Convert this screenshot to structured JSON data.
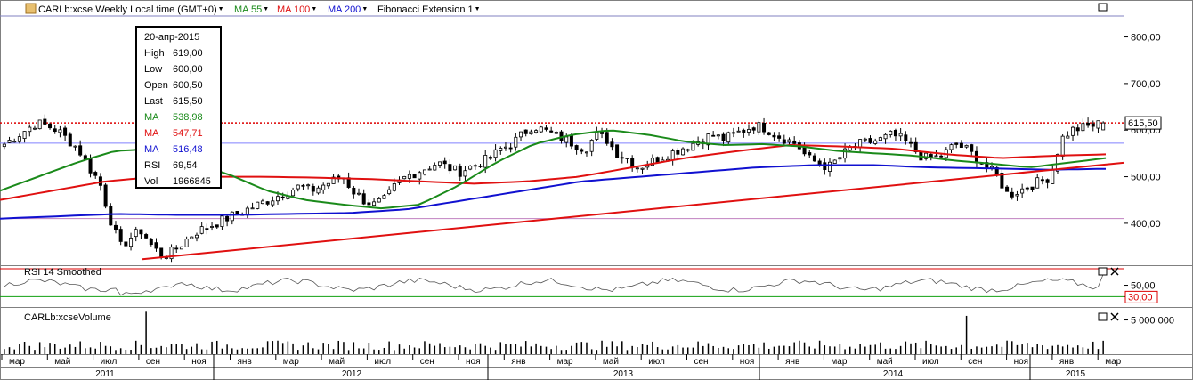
{
  "header": {
    "title": "CARLb:xcse Weekly Local time (GMT+0)",
    "ma55": "MA 55",
    "ma100": "MA 100",
    "ma200": "MA 200",
    "fib": "Fibonacci Extension 1"
  },
  "rsi_panel": {
    "title": "RSI 14 Smoothed"
  },
  "volume_panel": {
    "title": "CARLb:xcseVolume"
  },
  "tooltip": {
    "date": "20-апр-2015",
    "rows": [
      {
        "k": "High",
        "v": "619,00"
      },
      {
        "k": "Low",
        "v": "600,00"
      },
      {
        "k": "Open",
        "v": "600,50"
      },
      {
        "k": "Last",
        "v": "615,50"
      },
      {
        "k": "MA",
        "v": "538,98"
      },
      {
        "k": "MA",
        "v": "547,71"
      },
      {
        "k": "MA",
        "v": "516,48"
      },
      {
        "k": "RSI",
        "v": "69,54"
      },
      {
        "k": "Vol",
        "v": "1966845"
      }
    ]
  },
  "colors": {
    "ma55": "#1a8a1a",
    "ma100": "#e01010",
    "ma200": "#1010d0",
    "trend": "#e01010",
    "bg": "#ffffff",
    "grid": "#c0c0c0"
  },
  "chart_data": {
    "type": "candlestick",
    "price_axis": {
      "ticks": [
        "800,00",
        "700,00",
        "600,00",
        "500,00",
        "400,00"
      ],
      "tick_values": [
        800,
        700,
        600,
        500,
        400
      ],
      "ylim": [
        310,
        845
      ]
    },
    "current_price_label": "615,50",
    "current_price": 615.5,
    "reference_lines": [
      572,
      410
    ],
    "rsi_axis": {
      "ticks": [
        "50,00",
        "30,00"
      ],
      "tick_values": [
        50,
        30
      ],
      "ylim": [
        15,
        82
      ]
    },
    "volume_axis": {
      "ticks": [
        "5 000 000"
      ],
      "tick_values": [
        5000000
      ],
      "ylim": [
        0,
        6500000
      ]
    },
    "x_axis": {
      "months": [
        "мар",
        "май",
        "июл",
        "сен",
        "ноя",
        "янв",
        "мар",
        "май",
        "июл",
        "сен",
        "ноя",
        "янв",
        "мар",
        "май",
        "июл",
        "сен",
        "ноя",
        "янв",
        "мар",
        "май",
        "июл",
        "сен",
        "ноя",
        "янв",
        "мар"
      ],
      "years": [
        "2011",
        "2012",
        "2013",
        "2014",
        "2015"
      ]
    },
    "last_bar": {
      "date": "20-апр-2015",
      "high": 619.0,
      "low": 600.0,
      "open": 600.5,
      "close": 615.5,
      "ma55": 538.98,
      "ma100": 547.71,
      "ma200": 516.48,
      "rsi": 69.54,
      "volume": 1966845
    },
    "price_anchors": [
      570,
      585,
      600,
      615,
      610,
      600,
      580,
      560,
      520,
      490,
      410,
      350,
      370,
      385,
      350,
      330,
      340,
      360,
      380,
      390,
      400,
      410,
      420,
      430,
      440,
      450,
      460,
      470,
      480,
      470,
      480,
      490,
      500,
      470,
      450,
      440,
      450,
      480,
      500,
      510,
      520,
      530,
      520,
      510,
      520,
      530,
      540,
      560,
      570,
      590,
      610,
      600,
      590,
      580,
      570,
      560,
      590,
      580,
      550,
      540,
      520,
      530,
      540,
      550,
      560,
      570,
      580,
      590,
      580,
      590,
      600,
      610,
      605,
      590,
      580,
      570,
      540,
      530,
      520,
      540,
      560,
      570,
      575,
      580,
      590,
      580,
      560,
      540,
      540,
      550,
      570,
      560,
      540,
      520,
      500,
      460,
      470,
      480,
      490,
      500,
      580,
      600,
      605,
      610,
      615.5
    ],
    "ma55_anchors": [
      470,
      500,
      530,
      555,
      560,
      530,
      505,
      470,
      450,
      440,
      432,
      440,
      480,
      530,
      570,
      590,
      600,
      590,
      575,
      568,
      570,
      565,
      555,
      550,
      545,
      535,
      528,
      520,
      530,
      540
    ],
    "ma100_anchors": [
      450,
      470,
      490,
      500,
      500,
      500,
      498,
      495,
      490,
      485,
      490,
      500,
      520,
      540,
      555,
      568,
      565,
      560,
      548,
      540,
      545,
      548
    ],
    "ma200_anchors": [
      410,
      415,
      420,
      418,
      418,
      420,
      422,
      430,
      450,
      470,
      490,
      500,
      510,
      520,
      525,
      525,
      520,
      518,
      515,
      517
    ],
    "trend_line": {
      "x": [
        "2011-09",
        "2015-04"
      ],
      "y": [
        323,
        530
      ]
    }
  }
}
